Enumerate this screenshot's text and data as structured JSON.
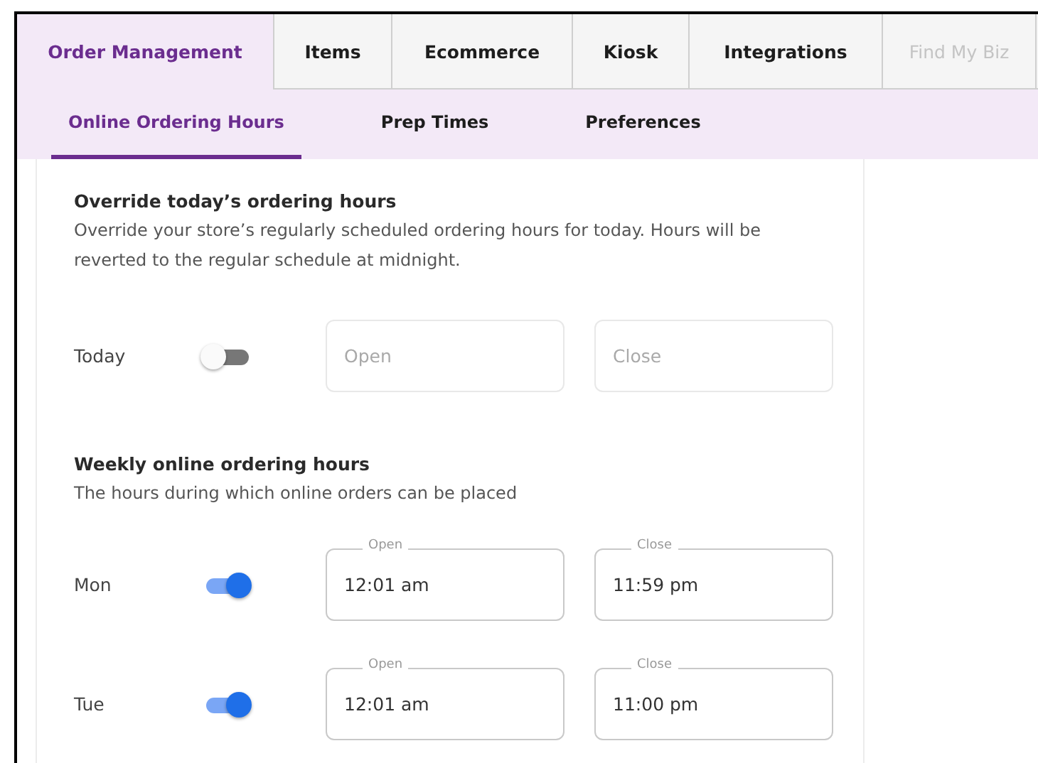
{
  "tabs": [
    {
      "label": "Order Management",
      "selected": true,
      "disabled": false
    },
    {
      "label": "Items",
      "selected": false,
      "disabled": false
    },
    {
      "label": "Ecommerce",
      "selected": false,
      "disabled": false
    },
    {
      "label": "Kiosk",
      "selected": false,
      "disabled": false
    },
    {
      "label": "Integrations",
      "selected": false,
      "disabled": false
    },
    {
      "label": "Find My Biz",
      "selected": false,
      "disabled": true
    }
  ],
  "subtabs": [
    {
      "label": "Online Ordering Hours",
      "selected": true
    },
    {
      "label": "Prep Times",
      "selected": false
    },
    {
      "label": "Preferences",
      "selected": false
    }
  ],
  "override": {
    "title": "Override today’s ordering hours",
    "description": "Override your store’s regularly scheduled ordering hours for today. Hours will be reverted to the regular schedule at midnight.",
    "row": {
      "day": "Today",
      "on": false,
      "open": {
        "placeholder": "Open"
      },
      "close": {
        "placeholder": "Close"
      }
    }
  },
  "weekly": {
    "title": "Weekly online ordering hours",
    "description": "The hours during which online orders can be placed",
    "rows": [
      {
        "day": "Mon",
        "on": true,
        "open": {
          "label": "Open",
          "value": "12:01 am"
        },
        "close": {
          "label": "Close",
          "value": "11:59 pm"
        }
      },
      {
        "day": "Tue",
        "on": true,
        "open": {
          "label": "Open",
          "value": "12:01 am"
        },
        "close": {
          "label": "Close",
          "value": "11:00 pm"
        }
      }
    ]
  }
}
